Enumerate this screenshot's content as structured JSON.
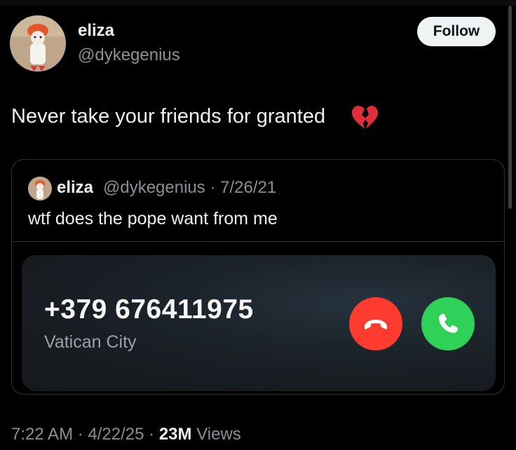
{
  "post": {
    "author_name": "eliza",
    "author_handle": "@dykegenius",
    "follow_label": "Follow",
    "text": "Never take your friends for granted",
    "emoji_icon": "broken-heart-icon",
    "footer": {
      "time": "7:22 AM",
      "separator": "·",
      "date": "4/22/25",
      "views_count": "23M",
      "views_label": "Views"
    }
  },
  "quote": {
    "author_name": "eliza",
    "meta": "@dykegenius · 7/26/21",
    "text": "wtf does the pope want from me"
  },
  "call": {
    "number": "+379 676411975",
    "location": "Vatican City",
    "decline_icon": "phone-hangup-icon",
    "accept_icon": "phone-icon",
    "decline_color": "#ff3b30",
    "accept_color": "#2fd159"
  },
  "colors": {
    "background": "#000000",
    "secondary_text": "#8b9096",
    "follow_bg": "#eff3f4"
  }
}
